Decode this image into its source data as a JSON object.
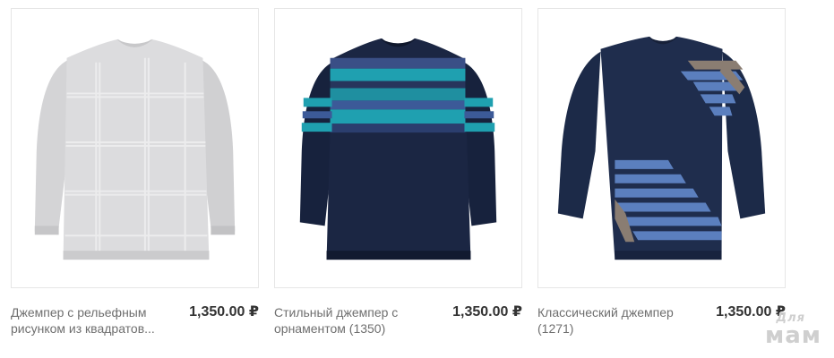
{
  "products": [
    {
      "title": "Джемпер с рельефным рисунком из квадратов...",
      "price": "1,350.00 ₽",
      "image_icon": "light-grey-textured-sweater-image"
    },
    {
      "title": "Стильный джемпер с орнаментом (1350)",
      "price": "1,350.00 ₽",
      "image_icon": "navy-ornament-sweater-image"
    },
    {
      "title": "Классический джемпер (1271)",
      "price": "1,350.00 ₽",
      "image_icon": "navy-striped-sweater-image"
    }
  ],
  "watermark": {
    "top": "Для",
    "bottom": "мам"
  },
  "colors": {
    "light_sweater": "#d9d9db",
    "navy": "#1c2a48",
    "teal": "#1f9fae",
    "stripe_blue": "#5b7fbe",
    "stripe_brown": "#8a7d72"
  }
}
